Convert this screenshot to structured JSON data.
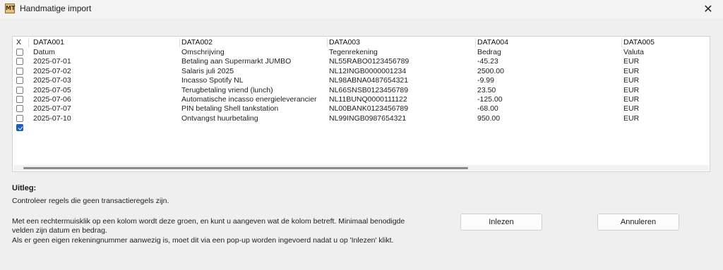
{
  "window": {
    "title": "Handmatige import",
    "app_icon": "MT",
    "close_glyph": "✕"
  },
  "grid": {
    "header_x": "X",
    "columns": [
      "DATA001",
      "DATA002",
      "DATA003",
      "DATA004",
      "DATA005"
    ],
    "rows": [
      {
        "checked": false,
        "cells": [
          "Datum",
          "Omschrijving",
          "Tegenrekening",
          "Bedrag",
          "Valuta"
        ]
      },
      {
        "checked": false,
        "cells": [
          "2025-07-01",
          "Betaling aan Supermarkt JUMBO",
          "NL55RABO0123456789",
          "-45.23",
          "EUR"
        ]
      },
      {
        "checked": false,
        "cells": [
          "2025-07-02",
          "Salaris juli 2025",
          "NL12INGB0000001234",
          "2500.00",
          "EUR"
        ]
      },
      {
        "checked": false,
        "cells": [
          "2025-07-03",
          "Incasso Spotify NL",
          "NL98ABNA0487654321",
          "-9.99",
          "EUR"
        ]
      },
      {
        "checked": false,
        "cells": [
          "2025-07-05",
          "Terugbetaling vriend (lunch)",
          "NL66SNSB0123456789",
          "23.50",
          "EUR"
        ]
      },
      {
        "checked": false,
        "cells": [
          "2025-07-06",
          "Automatische incasso energieleverancier",
          "NL11BUNQ0000111122",
          "-125.00",
          "EUR"
        ]
      },
      {
        "checked": false,
        "cells": [
          "2025-07-07",
          "PIN betaling Shell tankstation",
          "NL00BANK0123456789",
          "-68.00",
          "EUR"
        ]
      },
      {
        "checked": false,
        "cells": [
          "2025-07-10",
          "Ontvangst huurbetaling",
          "NL99INGB0987654321",
          "950.00",
          "EUR"
        ]
      },
      {
        "checked": true,
        "cells": [
          "",
          "",
          "",
          "",
          ""
        ]
      }
    ]
  },
  "uitleg": {
    "title": "Uitleg:",
    "line1": "Controleer regels die geen transactieregels zijn.",
    "line2": "Met een rechtermuisklik op een kolom wordt deze groen, en kunt u aangeven wat de kolom betreft. Minimaal benodigde",
    "line3": "velden zijn datum en bedrag.",
    "line4": "Als er geen eigen rekeningnummer aanwezig is, moet dit via een pop-up worden ingevoerd nadat u op 'Inlezen' klikt."
  },
  "buttons": {
    "inlezen": "Inlezen",
    "annuleren": "Annuleren"
  }
}
